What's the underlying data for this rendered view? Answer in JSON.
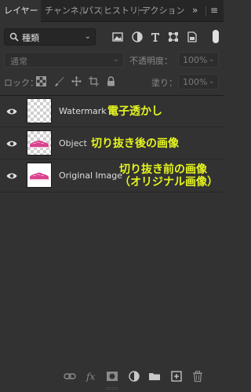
{
  "tabs": [
    {
      "label": "レイヤー",
      "active": true
    },
    {
      "label": "チャンネル",
      "active": false
    },
    {
      "label": "パス",
      "active": false
    },
    {
      "label": "ヒストリー",
      "active": false
    },
    {
      "label": "アクション",
      "active": false
    }
  ],
  "tab_overflow": "»",
  "panel_menu": "≡",
  "filter": {
    "kind_label": "種類",
    "icons": [
      "image-filter-icon",
      "adjustment-filter-icon",
      "type-filter-icon",
      "shape-filter-icon",
      "smart-object-filter-icon"
    ]
  },
  "blend": {
    "mode": "通常",
    "opacity_label": "不透明度：",
    "opacity_value": "100%",
    "fill_label": "塗り：",
    "fill_value": "100%"
  },
  "lock": {
    "label": "ロック：",
    "icons": [
      "lock-transparent-icon",
      "lock-image-icon",
      "lock-position-icon",
      "lock-artboard-icon",
      "lock-all-icon"
    ]
  },
  "layers": [
    {
      "name": "Watermark",
      "thumb": "transparent",
      "annotation": [
        "電子透かし"
      ],
      "visible": true
    },
    {
      "name": "Object",
      "thumb": "object",
      "annotation": [
        "切り抜き後の画像"
      ],
      "visible": true
    },
    {
      "name": "Original Image",
      "thumb": "original",
      "annotation": [
        "切り抜き前の画像",
        "（オリジナル画像）"
      ],
      "visible": true
    }
  ],
  "bottom_icons": [
    "link-layers-icon",
    "fx-icon",
    "layer-mask-icon",
    "adjustment-layer-icon",
    "group-folder-icon",
    "new-layer-icon",
    "trash-icon"
  ],
  "colors": {
    "annotation": "#e6f51e",
    "panel_bg": "#323232",
    "tabbar_bg": "#262626"
  }
}
